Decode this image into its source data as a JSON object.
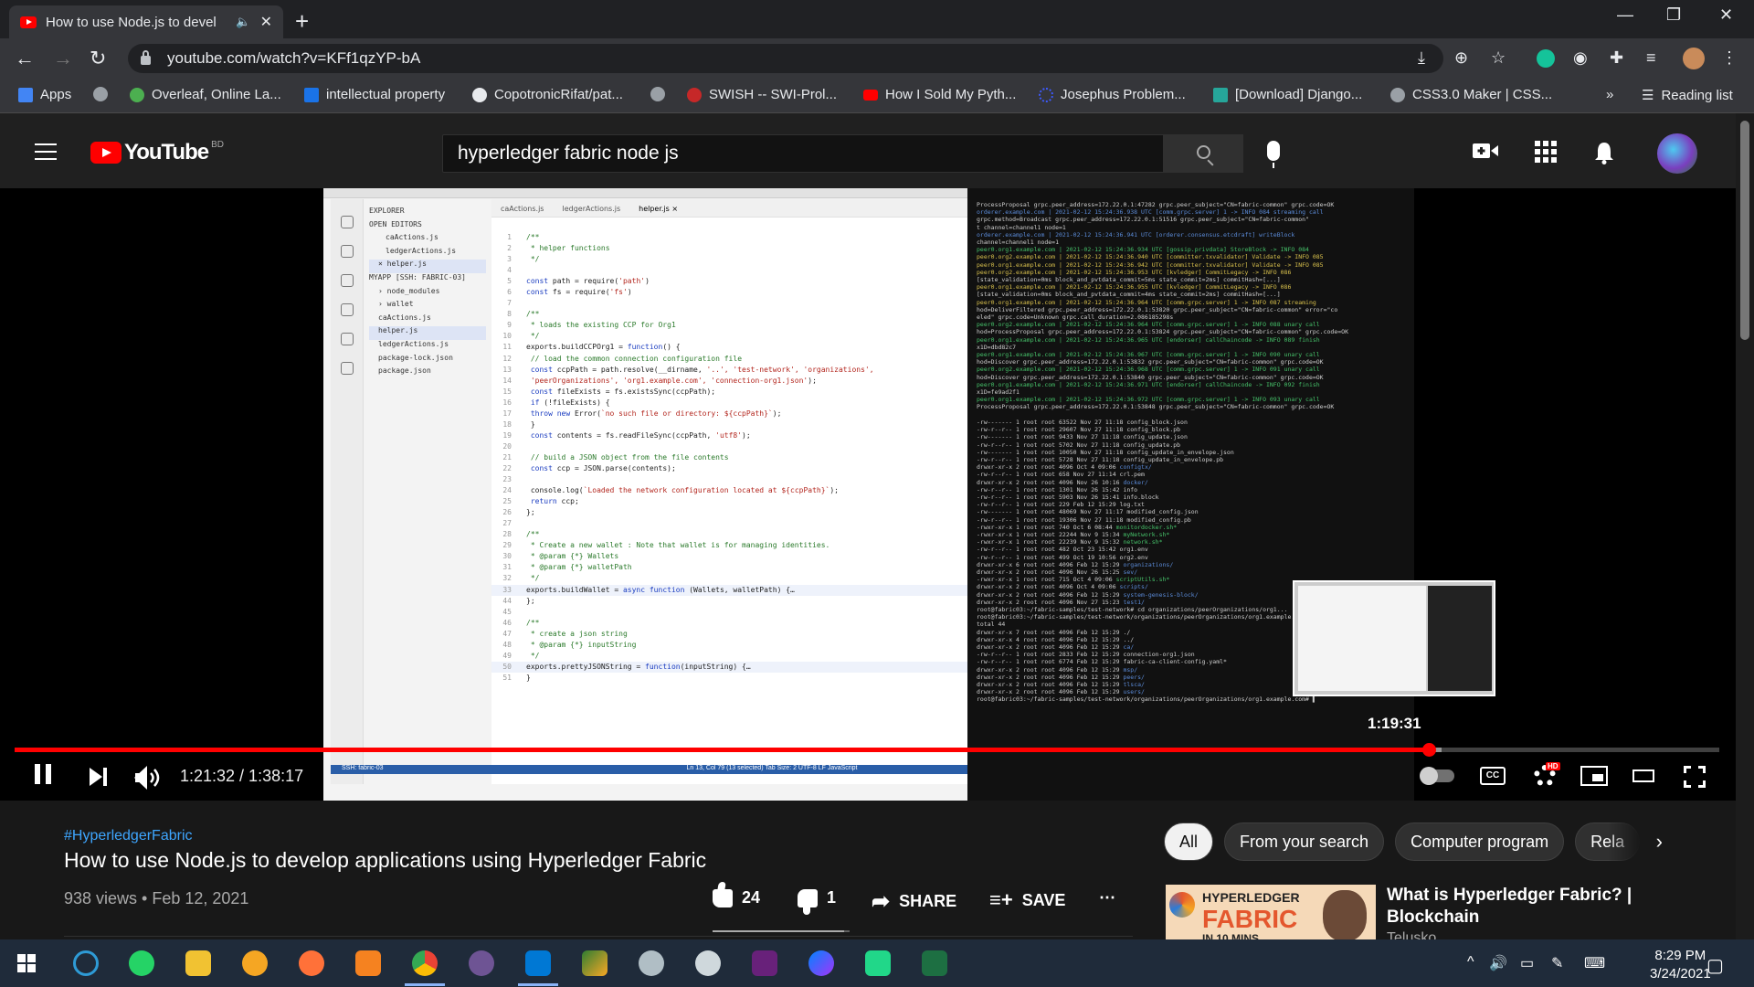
{
  "browser": {
    "tab_title": "How to use Node.js to devel",
    "url": "youtube.com/watch?v=KFf1qzYP-bA",
    "bookmarks": [
      {
        "label": "Apps",
        "color": "#4285f4"
      },
      {
        "label": "",
        "color": "#9aa0a6"
      },
      {
        "label": "Overleaf, Online La...",
        "color": "#4caf50"
      },
      {
        "label": "intellectual property",
        "color": "#1a73e8"
      },
      {
        "label": "CopotronicRifat/pat...",
        "color": "#e8eaed"
      },
      {
        "label": "",
        "color": "#9aa0a6"
      },
      {
        "label": "SWISH -- SWI-Prol...",
        "color": "#c62828"
      },
      {
        "label": "How I Sold My Pyth...",
        "color": "#ff0000"
      },
      {
        "label": "Josephus Problem...",
        "color": "#3d5afe"
      },
      {
        "label": "[Download] Django...",
        "color": "#26a69a"
      },
      {
        "label": "CSS3.0 Maker | CSS...",
        "color": "#9aa0a6"
      }
    ],
    "reading_list": "Reading list"
  },
  "youtube": {
    "country": "BD",
    "logo_text": "YouTube",
    "search_query": "hyperledger fabric node js"
  },
  "player": {
    "current_time": "1:21:32",
    "duration": "1:38:17",
    "time_display": "1:21:32 / 1:38:17",
    "hover_time": "1:19:31",
    "played_fraction": 0.8296,
    "buffered_fraction": 0.8372,
    "cc_label": "CC",
    "hd_badge": "HD"
  },
  "screen": {
    "explorer_items": [
      "EXPLORER",
      "OPEN EDITORS",
      "caActions.js",
      "ledgerActions.js",
      "× helper.js",
      "MYAPP [SSH: FABRIC-03]",
      "› node_modules",
      "› wallet",
      "caActions.js",
      "helper.js",
      "ledgerActions.js",
      "package-lock.json",
      "package.json"
    ],
    "editor_tabs": [
      "caActions.js",
      "ledgerActions.js",
      "helper.js ×"
    ],
    "status_left": "SSH: fabric-03",
    "status_right": "Ln 13, Col 79 (13 selected)   Tab Size: 2   UTF-8   LF   JavaScript"
  },
  "video_info": {
    "hashtag": "#HyperledgerFabric",
    "title": "How to use Node.js to develop applications using Hyperledger Fabric",
    "views_date": "938 views • Feb 12, 2021",
    "likes": "24",
    "dislikes": "1",
    "like_ratio": 0.96,
    "share_label": "SHARE",
    "save_label": "SAVE"
  },
  "chips": [
    "All",
    "From your search",
    "Computer program",
    "Rela"
  ],
  "recommended": {
    "title": "What is Hyperledger Fabric? | Blockchain",
    "channel": "Telusko",
    "thumb_tag": "HYPERLEDGER",
    "thumb_big": "FABRIC",
    "thumb_small": "IN 10 MINS"
  },
  "taskbar": {
    "time": "8:29 PM",
    "date": "3/24/2021"
  }
}
